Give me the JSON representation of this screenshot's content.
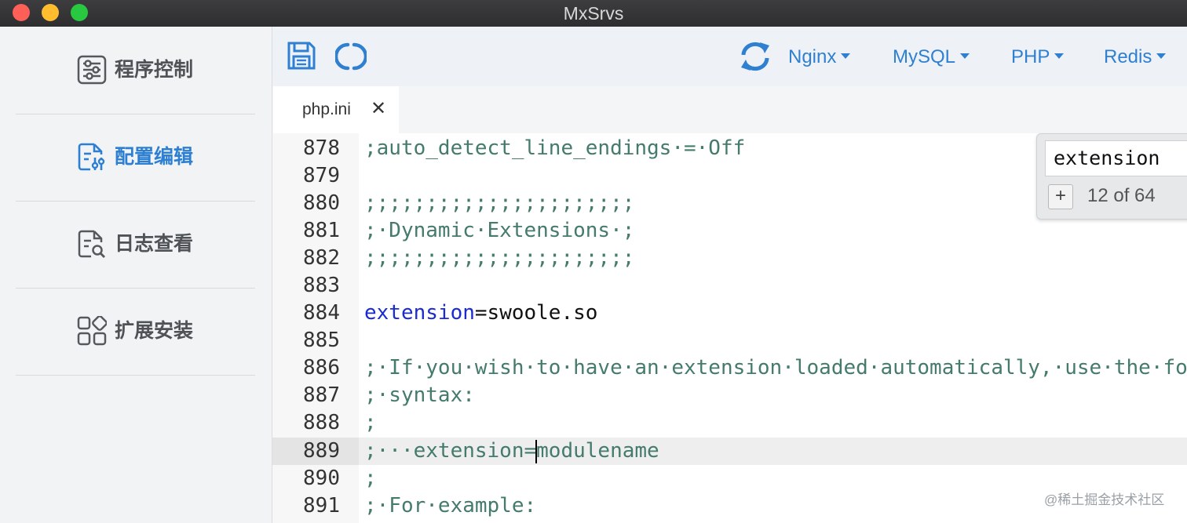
{
  "window": {
    "title": "MxSrvs"
  },
  "sidebar": {
    "items": [
      {
        "label": "程序控制",
        "icon": "sliders-icon",
        "active": false
      },
      {
        "label": "配置编辑",
        "icon": "config-edit-icon",
        "active": true
      },
      {
        "label": "日志查看",
        "icon": "log-search-icon",
        "active": false
      },
      {
        "label": "扩展安装",
        "icon": "apps-grid-icon",
        "active": false
      }
    ]
  },
  "toolbar": {
    "save_icon": "save-icon",
    "reload_icon": "reload-icon",
    "refresh_icon": "sync-icon",
    "menus": [
      {
        "label": "Nginx"
      },
      {
        "label": "MySQL"
      },
      {
        "label": "PHP"
      },
      {
        "label": "Redis"
      }
    ],
    "accent": "#2f80d1"
  },
  "tabs": [
    {
      "label": "php.ini",
      "close": "✕"
    }
  ],
  "editor": {
    "current_line": 889,
    "lines": [
      {
        "num": "878",
        "text": ";auto_detect_line_endings·=·Off"
      },
      {
        "num": "879",
        "text": ""
      },
      {
        "num": "880",
        "text": ";;;;;;;;;;;;;;;;;;;;;;"
      },
      {
        "num": "881",
        "text": ";·Dynamic·Extensions·;"
      },
      {
        "num": "882",
        "text": ";;;;;;;;;;;;;;;;;;;;;;"
      },
      {
        "num": "883",
        "text": ""
      },
      {
        "num": "884",
        "key": "extension",
        "value": "=swoole.so"
      },
      {
        "num": "885",
        "text": ""
      },
      {
        "num": "886",
        "text": ";·If·you·wish·to·have·an·extension·loaded·automatically,·use·the·fol"
      },
      {
        "num": "887",
        "text": ";·syntax:"
      },
      {
        "num": "888",
        "text": ";"
      },
      {
        "num": "889",
        "text": ";···extension=modulename"
      },
      {
        "num": "890",
        "text": ";"
      },
      {
        "num": "891",
        "text": ";·For·example:"
      }
    ],
    "colors": {
      "comment": "#447b6c",
      "keyword": "#1b2bd0"
    }
  },
  "search": {
    "query": "extension",
    "plus": "+",
    "count": "12 of 64"
  },
  "watermark": "@稀土掘金技术社区"
}
